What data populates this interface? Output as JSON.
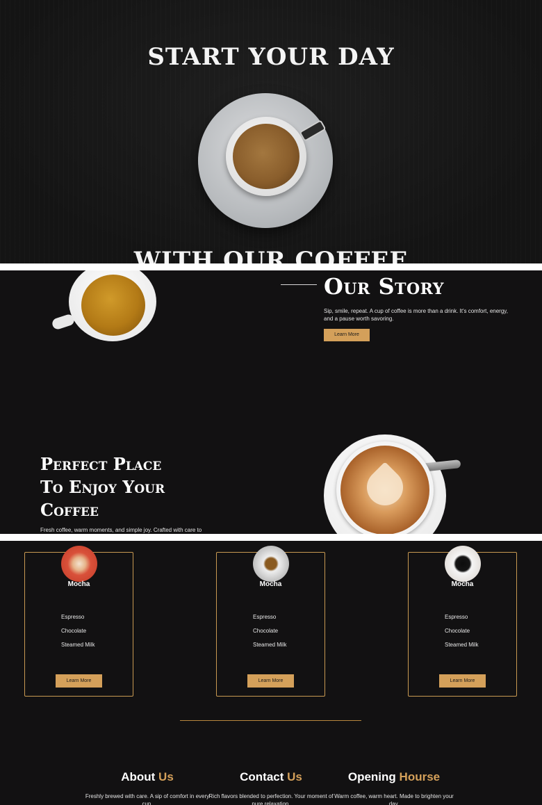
{
  "hero": {
    "title_top": "START YOUR DAY",
    "title_bottom": "WITH OUR COFFEE"
  },
  "story": {
    "title": "Our Story",
    "text": "Sip, smile, repeat. A cup of coffee is more than a drink. It's comfort, energy, and a pause worth savoring.",
    "button": "Learn More",
    "perfect_title_lines": [
      "Perfect Place",
      "To Enjoy Your",
      "Coffee"
    ],
    "perfect_text": "Fresh coffee, warm moments, and simple joy. Crafted with care to"
  },
  "menu": {
    "cards": [
      {
        "name": "Mocha",
        "items": [
          "Espresso",
          "Chocolate",
          "Steamed Milk"
        ],
        "button": "Learn More"
      },
      {
        "name": "Mocha",
        "items": [
          "Espresso",
          "Chocolate",
          "Steamed Milk"
        ],
        "button": "Learn More"
      },
      {
        "name": "Mocha",
        "items": [
          "Espresso",
          "Chocolate",
          "Steamed Milk"
        ],
        "button": "Learn More"
      }
    ]
  },
  "footer": {
    "about": {
      "title": "About",
      "accent": "Us",
      "text": "Freshly brewed with care. A sip of comfort in every cup."
    },
    "contact": {
      "title": "Contact",
      "accent": "Us",
      "text": "Rich flavors blended to perfection. Your moment of pure relaxation."
    },
    "hours": {
      "title": "Opening",
      "accent": "Hourse",
      "text": "Warm coffee, warm heart. Made to brighten your day."
    }
  },
  "colors": {
    "accent": "#d4a05a",
    "background": "#121112"
  }
}
